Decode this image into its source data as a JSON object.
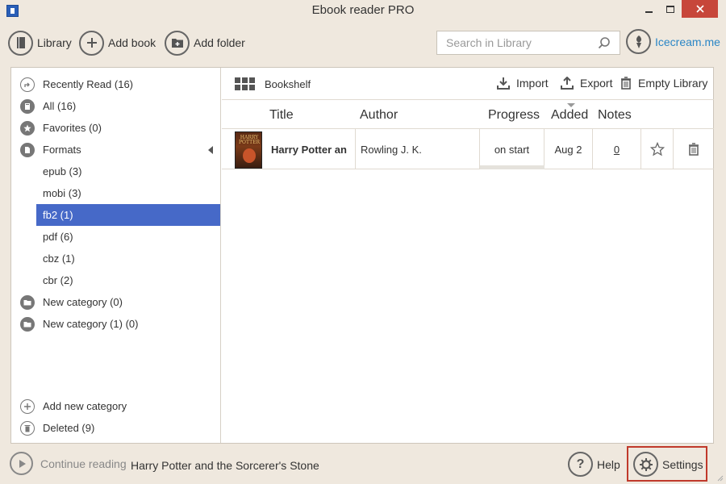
{
  "window": {
    "title": "Ebook reader PRO"
  },
  "toolbar": {
    "library_label": "Library",
    "add_book_label": "Add book",
    "add_folder_label": "Add folder",
    "search_placeholder": "Search in Library",
    "brand_label": "Icecream.me"
  },
  "sidebar": {
    "items": [
      {
        "label": "Recently Read (16)",
        "icon": "share-icon"
      },
      {
        "label": "All (16)",
        "icon": "books-icon"
      },
      {
        "label": "Favorites (0)",
        "icon": "star-icon"
      },
      {
        "label": "Formats",
        "icon": "document-icon"
      },
      {
        "label": "epub (3)"
      },
      {
        "label": "mobi (3)"
      },
      {
        "label": "fb2 (1)",
        "active": true
      },
      {
        "label": "pdf (6)"
      },
      {
        "label": "cbz (1)"
      },
      {
        "label": "cbr (2)"
      },
      {
        "label": "New category (0)",
        "icon": "folder-icon"
      },
      {
        "label": "New category (1) (0)",
        "icon": "folder-icon"
      }
    ],
    "add_category_label": "Add new category",
    "deleted_label": "Deleted (9)"
  },
  "content": {
    "view_label": "Bookshelf",
    "import_label": "Import",
    "export_label": "Export",
    "empty_label": "Empty Library",
    "columns": {
      "title": "Title",
      "author": "Author",
      "progress": "Progress",
      "added": "Added",
      "notes": "Notes"
    },
    "sort_column": "Added",
    "books": [
      {
        "title": "Harry Potter an",
        "author": "Rowling J. K.",
        "progress": "on start",
        "added": "Aug 2",
        "notes": "0",
        "cover_text": "HARRY POTTER"
      }
    ]
  },
  "footer": {
    "continue_label": "Continue reading",
    "book_title": "Harry Potter and the Sorcerer's Stone",
    "help_label": "Help",
    "settings_label": "Settings"
  },
  "colors": {
    "background": "#efe8de",
    "active_item": "#4669c8",
    "brand": "#2a86c6",
    "close_button": "#c7463a",
    "highlight_border": "#c0392b"
  }
}
